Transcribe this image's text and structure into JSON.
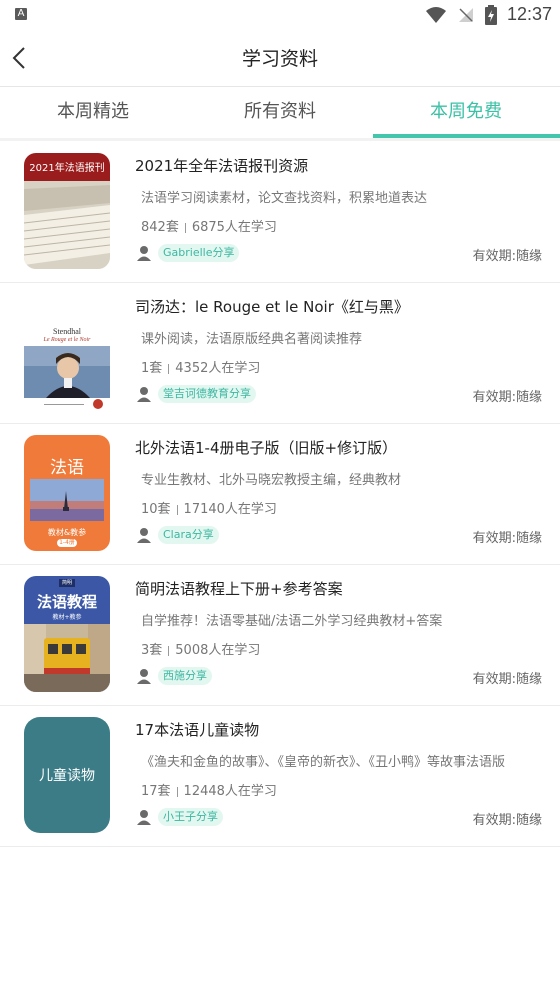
{
  "status_bar": {
    "indicator": "A",
    "time": "12:37",
    "icons": [
      "wifi-icon",
      "no-signal-icon",
      "battery-icon"
    ]
  },
  "header": {
    "title": "学习资料"
  },
  "tabs": [
    {
      "label": "本周精选",
      "active": false
    },
    {
      "label": "所有资料",
      "active": false
    },
    {
      "label": "本周免费",
      "active": true
    }
  ],
  "colors": {
    "accent": "#43c6ab",
    "tag_bg": "#e3f7f1"
  },
  "items": [
    {
      "title": "2021年全年法语报刊资源",
      "desc": "法语学习阅读素材，论文查找资料，积累地道表达",
      "count": "842套",
      "learners": "6875人在学习",
      "share": "Gabrielle分享",
      "validity": "有效期:随缘",
      "cover": {
        "label": "2021年法语报刊"
      }
    },
    {
      "title": "司汤达：le Rouge et le Noir《红与黑》",
      "desc": "课外阅读，法语原版经典名著阅读推荐",
      "count": "1套",
      "learners": "4352人在学习",
      "share": "堂吉诃德教育分享",
      "validity": "有效期:随缘",
      "cover": {
        "author": "Stendhal",
        "subtitle": "Le Rouge et le Noir"
      }
    },
    {
      "title": "北外法语1-4册电子版（旧版+修订版）",
      "desc": "专业生教材、北外马晓宏教授主编，经典教材",
      "count": "10套",
      "learners": "17140人在学习",
      "share": "Clara分享",
      "validity": "有效期:随缘",
      "cover": {
        "label": "法语",
        "sub": "教材&教参",
        "badge": "1-4册"
      }
    },
    {
      "title": "简明法语教程上下册+参考答案",
      "desc": "自学推荐！法语零基础/法语二外学习经典教材+答案",
      "count": "3套",
      "learners": "5008人在学习",
      "share": "西施分享",
      "validity": "有效期:随缘",
      "cover": {
        "top": "简明",
        "label": "法语教程",
        "sub": "教材+教参"
      }
    },
    {
      "title": "17本法语儿童读物",
      "desc": "《渔夫和金鱼的故事》、《皇帝的新衣》、《丑小鸭》等故事法语版",
      "count": "17套",
      "learners": "12448人在学习",
      "share": "小王子分享",
      "validity": "有效期:随缘",
      "cover": {
        "label": "儿童读物"
      }
    }
  ]
}
